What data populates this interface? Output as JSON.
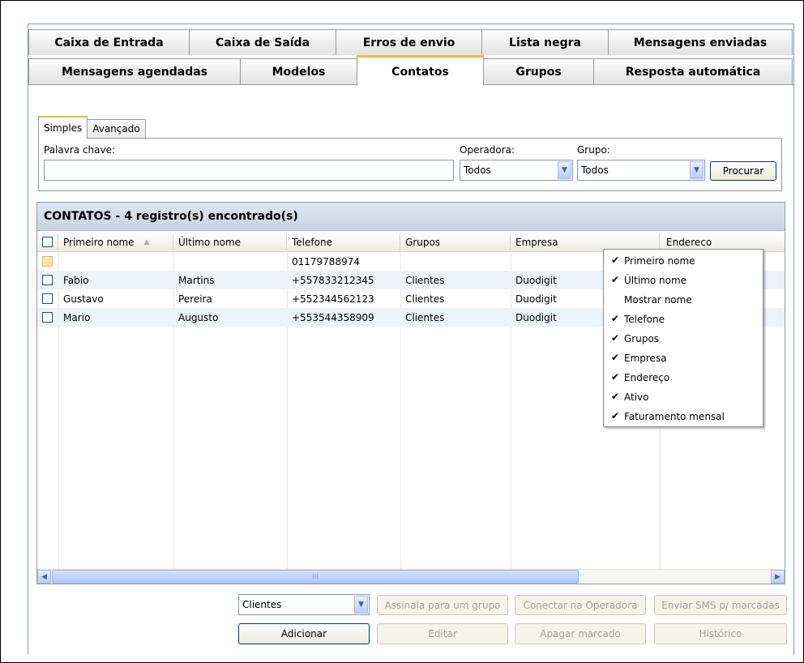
{
  "tabs_row1": [
    "Caixa de Entrada",
    "Caixa de Saída",
    "Erros de envio",
    "Lista negra",
    "Mensagens enviadas"
  ],
  "tabs_row2": [
    "Mensagens agendadas",
    "Modelos",
    "Contatos",
    "Grupos",
    "Resposta automática"
  ],
  "search": {
    "tabs": [
      "Simples",
      "Avançado"
    ],
    "keyword_label": "Palavra chave:",
    "keyword_value": "",
    "operator_label": "Operadora:",
    "operator_value": "Todos",
    "group_label": "Grupo:",
    "group_value": "Todos",
    "search_button": "Procurar"
  },
  "grid": {
    "title": "CONTATOS - 4 registro(s) encontrado(s)",
    "columns": [
      "Primeiro nome",
      "Último nome",
      "Telefone",
      "Grupos",
      "Empresa",
      "Endereco"
    ],
    "rows": [
      [
        "",
        "",
        "01179788974",
        "",
        ""
      ],
      [
        "Fabio",
        "Martins",
        "+557833212345",
        "Clientes",
        "Duodigit"
      ],
      [
        "Gustavo",
        "Pereira",
        "+552344562123",
        "Clientes",
        "Duodigit"
      ],
      [
        "Mario",
        "Augusto",
        "+553544358909",
        "Clientes",
        "Duodigit"
      ]
    ],
    "scroll_grip": "III"
  },
  "context_menu": [
    {
      "label": "Primeiro nome",
      "checked": true
    },
    {
      "label": "Último nome",
      "checked": true
    },
    {
      "label": "Mostrar nome",
      "checked": false
    },
    {
      "label": "Telefone",
      "checked": true
    },
    {
      "label": "Grupos",
      "checked": true
    },
    {
      "label": "Empresa",
      "checked": true
    },
    {
      "label": "Endereço",
      "checked": true
    },
    {
      "label": "Ativo",
      "checked": true
    },
    {
      "label": "Faturamento mensal",
      "checked": true
    }
  ],
  "bottom": {
    "group_select": "Clientes",
    "assign_button": "Assinala para um grupo",
    "connect_button": "Conectar na Operadora",
    "send_button": "Enviar SMS p/ marcadas",
    "add_button": "Adicionar",
    "edit_button": "Editar",
    "delete_button": "Apagar marcado",
    "history_button": "Histórico"
  }
}
